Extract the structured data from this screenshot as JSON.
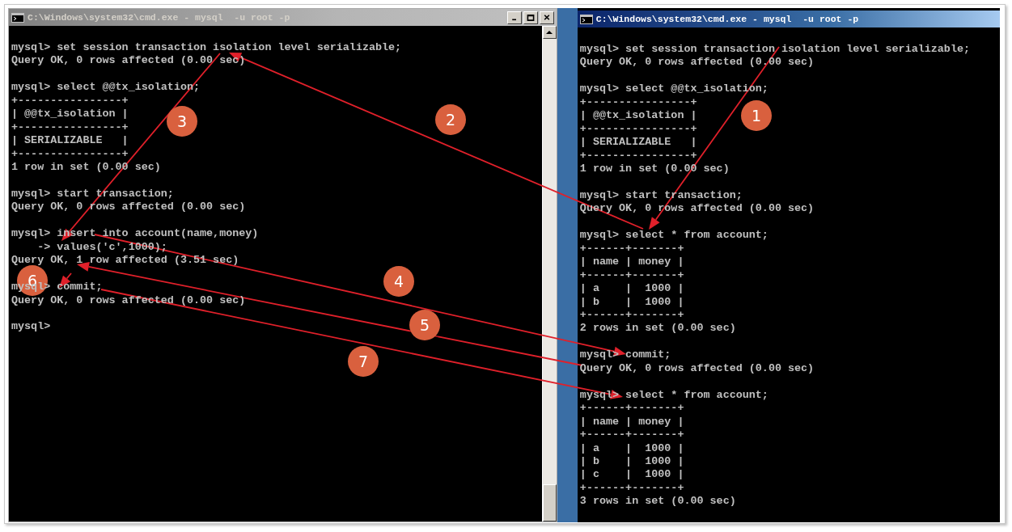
{
  "windows": [
    {
      "title": "C:\\Windows\\system32\\cmd.exe - mysql  -u root -p",
      "active": false,
      "title_buttons": true,
      "scrollbar": true,
      "blocks": [
        [
          "mysql> set session transaction isolation level serializable;",
          "Query OK, 0 rows affected (0.00 sec)"
        ],
        [
          "mysql> select @@tx_isolation;",
          "+----------------+",
          "| @@tx_isolation |",
          "+----------------+",
          "| SERIALIZABLE   |",
          "+----------------+",
          "1 row in set (0.00 sec)"
        ],
        [
          "mysql> start transaction;",
          "Query OK, 0 rows affected (0.00 sec)"
        ],
        [
          "mysql> insert into account(name,money)",
          "    -> values('c',1000);",
          "Query OK, 1 row affected (3.51 sec)"
        ],
        [
          "mysql> commit;",
          "Query OK, 0 rows affected (0.00 sec)"
        ],
        [
          "mysql>"
        ]
      ]
    },
    {
      "title": "C:\\Windows\\system32\\cmd.exe - mysql  -u root -p",
      "active": true,
      "title_buttons": false,
      "scrollbar": false,
      "blocks": [
        [
          "mysql> set session transaction isolation level serializable;",
          "Query OK, 0 rows affected (0.00 sec)"
        ],
        [
          "mysql> select @@tx_isolation;",
          "+----------------+",
          "| @@tx_isolation |",
          "+----------------+",
          "| SERIALIZABLE   |",
          "+----------------+",
          "1 row in set (0.00 sec)"
        ],
        [
          "mysql> start transaction;",
          "Query OK, 0 rows affected (0.00 sec)"
        ],
        [
          "mysql> select * from account;",
          "+------+-------+",
          "| name | money |",
          "+------+-------+",
          "| a    |  1000 |",
          "| b    |  1000 |",
          "+------+-------+",
          "2 rows in set (0.00 sec)"
        ],
        [
          "mysql> commit;",
          "Query OK, 0 rows affected (0.00 sec)"
        ],
        [
          "mysql> select * from account;",
          "+------+-------+",
          "| name | money |",
          "+------+-------+",
          "| a    |  1000 |",
          "| b    |  1000 |",
          "| c    |  1000 |",
          "+------+-------+",
          "3 rows in set (0.00 sec)"
        ]
      ]
    }
  ],
  "steps": [
    {
      "label": "3"
    },
    {
      "label": "2"
    },
    {
      "label": "1"
    },
    {
      "label": "6"
    },
    {
      "label": "4"
    },
    {
      "label": "5"
    },
    {
      "label": "7"
    }
  ]
}
